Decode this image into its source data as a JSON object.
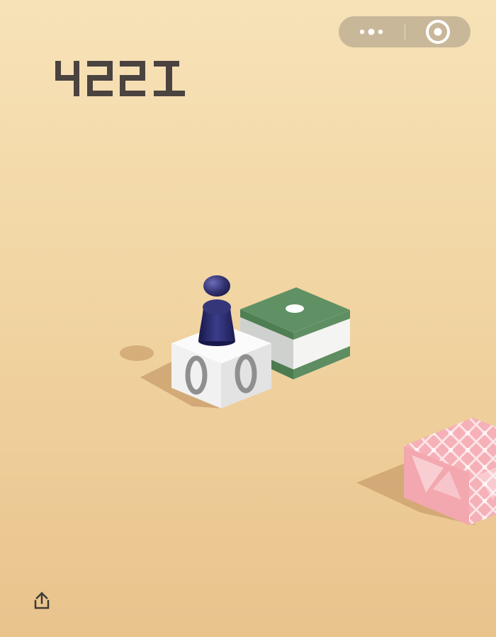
{
  "game": {
    "score": "4221"
  },
  "topbar": {
    "menu_icon": "more-dots-icon",
    "close_icon": "target-icon"
  },
  "share": {
    "icon": "share-upload-icon"
  },
  "colors": {
    "background_top": "#f7e2b8",
    "background_bottom": "#e9c38c",
    "score_text": "#4a4340",
    "white_block": "#f2f2f2",
    "green_block": "#5e8f62",
    "pink_block": "#f3a5ad",
    "player": "#2a2a63"
  }
}
